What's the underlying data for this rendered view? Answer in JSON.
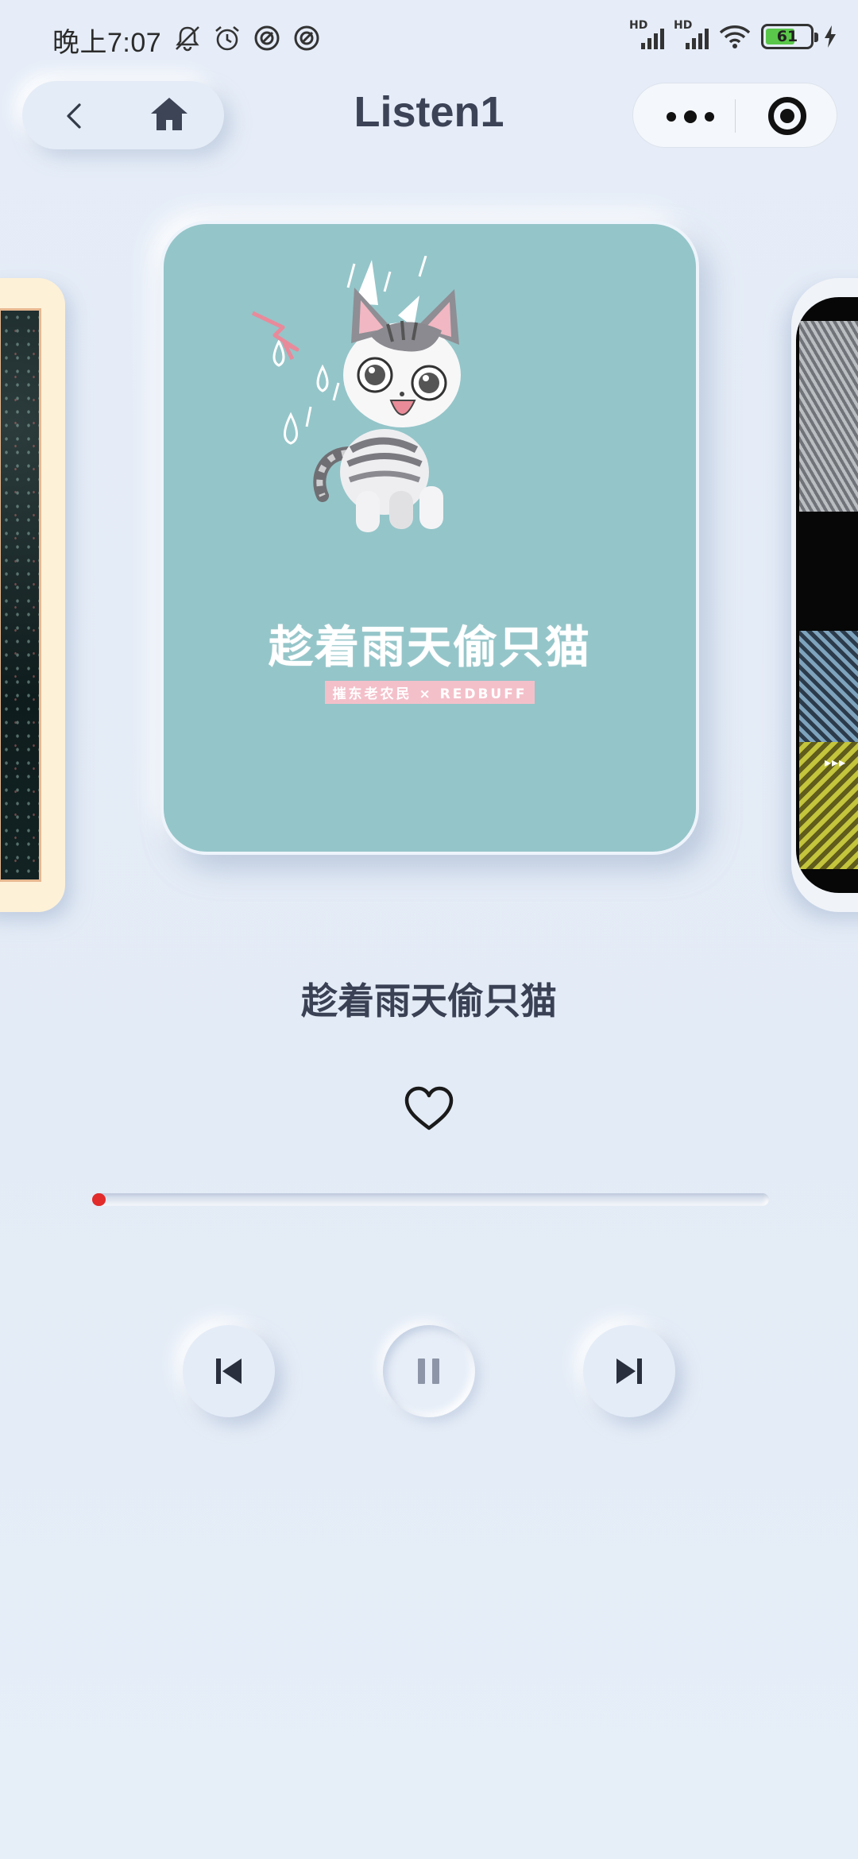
{
  "status_bar": {
    "time": "晚上7:07",
    "left_icons": [
      "mute-bell-icon",
      "alarm-icon",
      "circle-a-icon",
      "circle-a-icon"
    ],
    "signal_label": "HD",
    "battery_level": "61",
    "charging": true
  },
  "nav": {
    "title": "Listen1",
    "back_icon": "chevron-left-icon",
    "home_icon": "home-icon",
    "more_icon": "more-dots-icon",
    "close_icon": "target-circle-icon"
  },
  "album": {
    "title_art": "趁着雨天偷只猫",
    "subtitle_art": "摧东老农民 × REDBUFF",
    "background_color": "#94c5c9"
  },
  "song": {
    "title": "趁着雨天偷只猫",
    "liked": false
  },
  "player": {
    "progress": 0.02,
    "prev_icon": "skip-previous-icon",
    "pause_icon": "pause-icon",
    "next_icon": "skip-next-icon",
    "accent_color": "#e22b2b"
  }
}
